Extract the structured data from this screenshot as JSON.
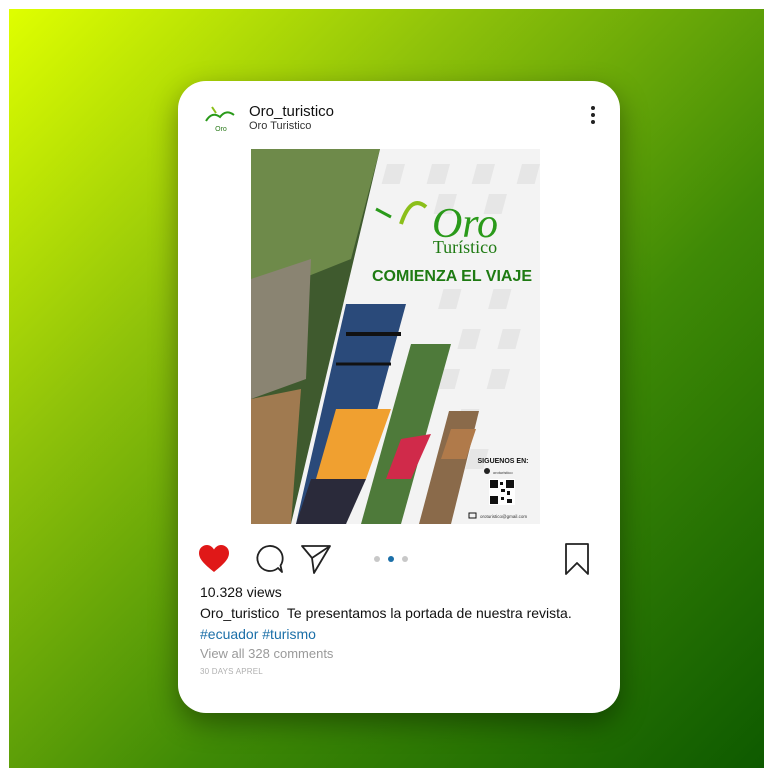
{
  "colors": {
    "heart": "#e01818",
    "hashtag": "#1b6fa8",
    "brand_green": "#2a9a1a",
    "active_dot": "#1b6fa8"
  },
  "profile": {
    "avatar_text": "Oro",
    "username": "Oro_turistico",
    "subtitle": "Oro Turistico"
  },
  "post": {
    "logo_main": "Oro",
    "logo_sub": "Turístico",
    "headline": "COMIENZA EL VIAJE",
    "follow_label": "SIGUENOS EN:",
    "social_handle": "oroturistico",
    "email": "oroturistico@gmail.com"
  },
  "actions": {
    "like_icon": "heart-icon",
    "comment_icon": "comment-icon",
    "share_icon": "send-icon",
    "save_icon": "bookmark-icon",
    "carousel": {
      "count": 3,
      "active": 2
    }
  },
  "views": "10.328 views",
  "caption": {
    "user": "Oro_turistico",
    "text": "Te presentamos la portada de nuestra revista."
  },
  "hashtags": "#ecuador #turismo",
  "comments_link": "View all 328 comments",
  "date": "30 DAYS APREL"
}
